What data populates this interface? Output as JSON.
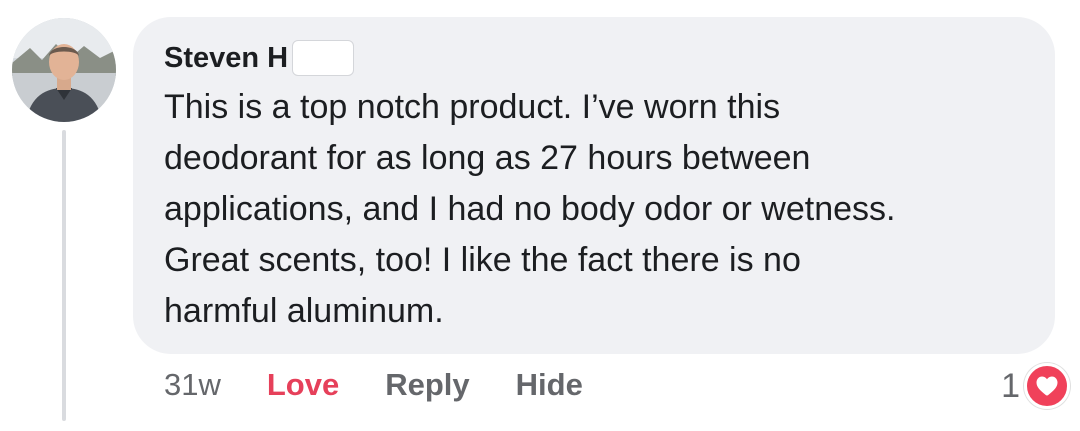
{
  "comment": {
    "author": "Steven H",
    "text": "This is a top notch product. I’ve worn this\ndeodorant for as long as 27 hours between\napplications, and I had no body odor or wetness.\nGreat scents, too!  I like the fact there is no\nharmful aluminum.",
    "timestamp": "31w",
    "actions": {
      "love": "Love",
      "reply": "Reply",
      "hide": "Hide"
    },
    "reaction_count": "1",
    "reaction_icon": "heart-icon"
  },
  "colors": {
    "bubble": "#f0f1f4",
    "love_accent": "#e6405a",
    "secondary_text": "#65676b",
    "primary_text": "#1c1e21"
  }
}
